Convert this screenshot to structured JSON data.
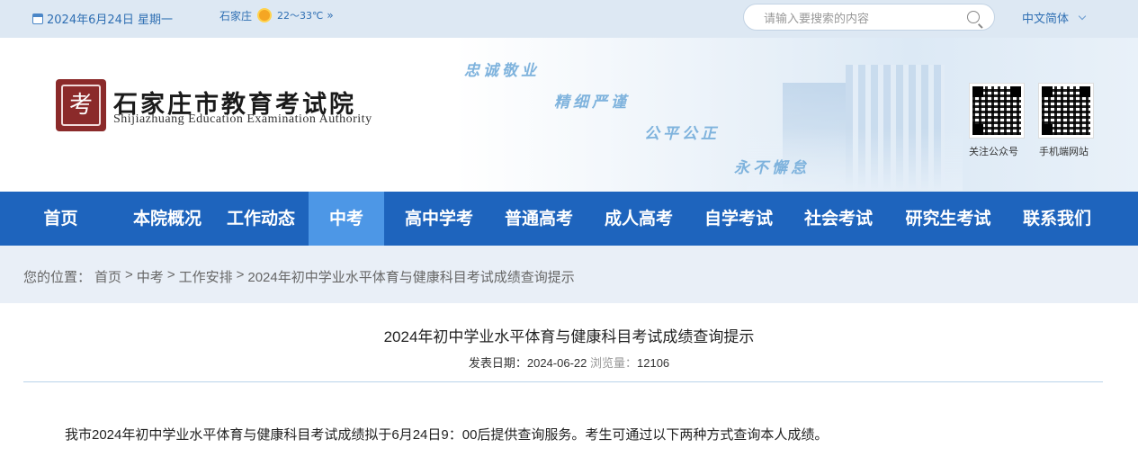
{
  "topbar": {
    "date": "2024年6月24日 星期一",
    "city": "石家庄",
    "temperature": "22～33℃",
    "more": "»",
    "search_placeholder": "请输入要搜索的内容",
    "language": "中文简体"
  },
  "header": {
    "seal_char": "考",
    "org_name_cn": "石家庄市教育考试院",
    "org_name_en": "Shijiazhuang Education Examination Authority",
    "slogans": [
      "忠诚敬业",
      "精细严谨",
      "公平公正",
      "永不懈怠"
    ],
    "qr_labels": [
      "关注公众号",
      "手机端网站"
    ]
  },
  "nav": {
    "items": [
      {
        "label": "首页"
      },
      {
        "label": "本院概况"
      },
      {
        "label": "工作动态"
      },
      {
        "label": "中考"
      },
      {
        "label": "高中学考"
      },
      {
        "label": "普通高考"
      },
      {
        "label": "成人高考"
      },
      {
        "label": "自学考试"
      },
      {
        "label": "社会考试"
      },
      {
        "label": "研究生考试"
      },
      {
        "label": "联系我们"
      }
    ],
    "active_index": 3
  },
  "breadcrumb": {
    "prefix": "您的位置：",
    "items": [
      "首页",
      "中考",
      "工作安排",
      "2024年初中学业水平体育与健康科目考试成绩查询提示"
    ],
    "separator": ">"
  },
  "article": {
    "title": "2024年初中学业水平体育与健康科目考试成绩查询提示",
    "publish_label": "发表日期：",
    "publish_date": "2024-06-22",
    "views_label": "浏览量：",
    "views": "12106",
    "body_first_line": "我市2024年初中学业水平体育与健康科目考试成绩拟于6月24日9：00后提供查询服务。考生可通过以下两种方式查询本人成绩。"
  },
  "colors": {
    "nav_bg": "#1e64bd",
    "nav_active": "#4d97e6",
    "topbar_bg": "#dde8f3",
    "breadcrumb_bg": "#e9eff7"
  }
}
